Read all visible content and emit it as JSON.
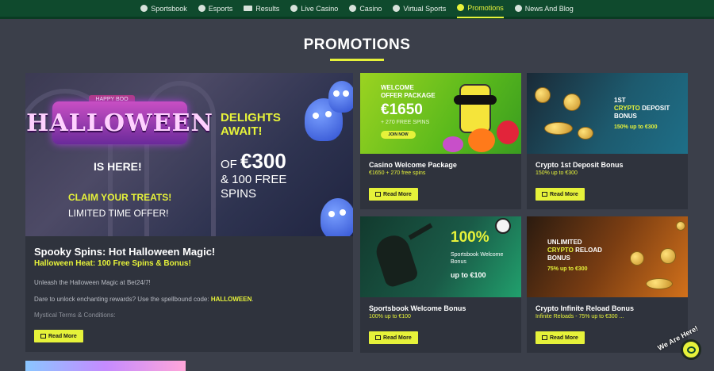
{
  "nav": {
    "items": [
      {
        "label": "Sportsbook",
        "icon": "soccer-ball-icon"
      },
      {
        "label": "Esports",
        "icon": "gamepad-icon"
      },
      {
        "label": "Results",
        "icon": "ticket-icon"
      },
      {
        "label": "Live Casino",
        "icon": "live-icon"
      },
      {
        "label": "Casino",
        "icon": "casino-chip-icon"
      },
      {
        "label": "Virtual Sports",
        "icon": "virtual-icon"
      },
      {
        "label": "Promotions",
        "icon": "promo-icon",
        "active": true
      },
      {
        "label": "News And Blog",
        "icon": "blog-icon"
      }
    ]
  },
  "page": {
    "title": "PROMOTIONS"
  },
  "featured": {
    "banner": {
      "logo_top": "HAPPY BOO",
      "logo": "HALLOWEEN",
      "is_here": "IS HERE!",
      "claim": "CLAIM YOUR TREATS!",
      "limited": "LIMITED TIME OFFER!",
      "delights": "DELIGHTS AWAIT!",
      "of": "OF",
      "amount": "€300",
      "spins": "& 100 FREE SPINS"
    },
    "title": "Spooky Spins: Hot Halloween Magic!",
    "subtitle": "Halloween Heat: 100 Free Spins & Bonus!",
    "desc": "Unleash the Halloween Magic at Bet24/7!",
    "desc2_prefix": "Dare to unlock enchanting rewards? Use the spellbound code:",
    "code": "HALLOWEEN",
    "desc2_suffix": ".",
    "terms": "Mystical Terms & Conditions:",
    "button": "Read More"
  },
  "cards": [
    {
      "banner_head": "WELCOME OFFER PACKAGE",
      "banner_big": "€1650",
      "banner_small": "+ 270 FREE SPINS",
      "banner_btn": "JOIN NOW",
      "title": "Casino Welcome Package",
      "sub": "€1650 + 270 free spins",
      "button": "Read More"
    },
    {
      "banner_head_1": "1ST",
      "banner_head_2": "CRYPTO",
      "banner_head_3": "DEPOSIT BONUS",
      "banner_small": "150% up to €300",
      "title": "Crypto 1st Deposit Bonus",
      "sub": "150% up to €300",
      "button": "Read More"
    },
    {
      "banner_big": "100%",
      "banner_small": "Sportsbook Welcome Bonus",
      "banner_upto": "up to €100",
      "title": "Sportsbook Welcome Bonus",
      "sub": "100% up to €100",
      "button": "Read More"
    },
    {
      "banner_head_1": "UNLIMITED",
      "banner_head_2": "CRYPTO",
      "banner_head_3": "RELOAD BONUS",
      "banner_small": "75% up to €300",
      "title": "Crypto Infinite Reload Bonus",
      "sub": "Infinite Reloads - 75% up to €300 ...",
      "button": "Read More"
    }
  ],
  "chat": {
    "label": "We Are Here!"
  },
  "colors": {
    "accent": "#e6f23a",
    "nav_bg": "#0f4a2d",
    "page_bg": "#3b3f4a",
    "card_bg": "#2f333d"
  }
}
